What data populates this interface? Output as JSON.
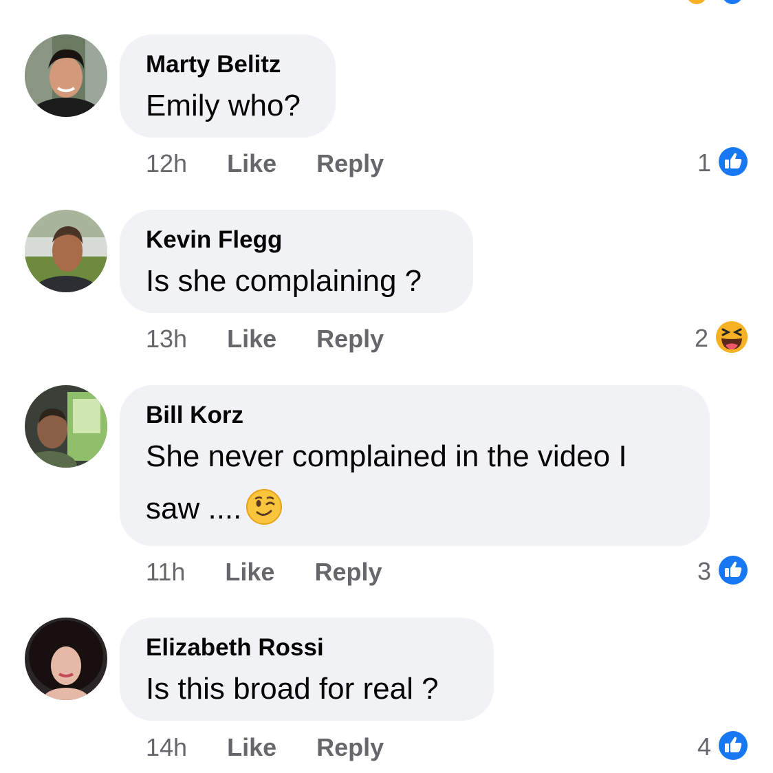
{
  "colors": {
    "bubble_bg": "#f0f2f5",
    "meta_text": "#65676b",
    "like_blue": "#1877f2",
    "haha_yellow": "#f7b125"
  },
  "actions": {
    "like": "Like",
    "reply": "Reply"
  },
  "comments": [
    {
      "author": "Marty Belitz",
      "text": "Emily who?",
      "time": "12h",
      "reaction_count": "1",
      "reaction_icon": "thumbs-up-icon"
    },
    {
      "author": "Kevin Flegg",
      "text": "Is she complaining ?",
      "time": "13h",
      "reaction_count": "2",
      "reaction_icon": "haha-face-icon"
    },
    {
      "author": "Bill Korz",
      "text_line1": "She never complained in  the video I",
      "text_line2": "saw ....",
      "text_emoji": "winking-face-icon",
      "time": "11h",
      "reaction_count": "3",
      "reaction_icon": "thumbs-up-icon"
    },
    {
      "author": "Elizabeth Rossi",
      "text": "Is this broad for real ?",
      "time": "14h",
      "reaction_count": "4",
      "reaction_icon": "thumbs-up-icon"
    }
  ]
}
